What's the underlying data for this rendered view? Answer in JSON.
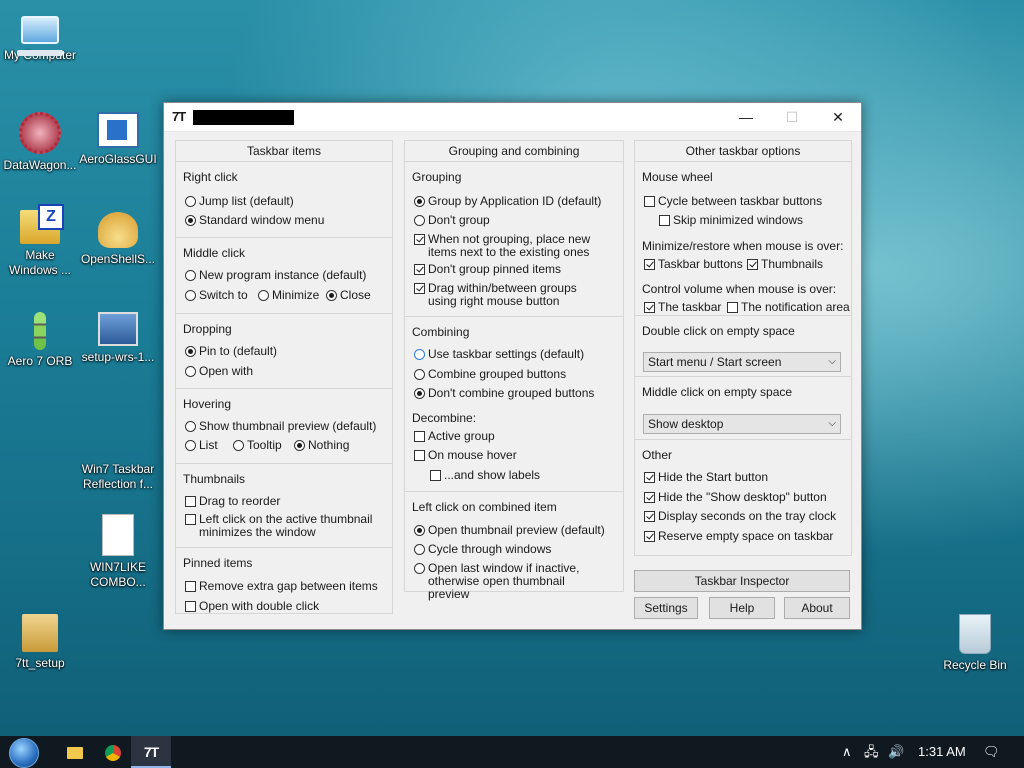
{
  "desktop": {
    "icons": [
      {
        "label": "My Computer",
        "icon": "computer-icon"
      },
      {
        "label": "DataWagon...",
        "icon": "network-icon"
      },
      {
        "label": "AeroGlassGUI",
        "icon": "window-icon"
      },
      {
        "label": "Make Windows ...",
        "icon": "zip-icon"
      },
      {
        "label": "OpenShellS...",
        "icon": "shell-icon"
      },
      {
        "label": "Aero 7 ORB",
        "icon": "orb-icon"
      },
      {
        "label": "setup-wrs-1...",
        "icon": "setup-icon"
      },
      {
        "label": "Win7 Taskbar Reflection f...",
        "icon": "blank-icon"
      },
      {
        "label": "WIN7LIKE COMBO...",
        "icon": "file-icon"
      },
      {
        "label": "7tt_setup",
        "icon": "installer-icon"
      },
      {
        "label": "Recycle Bin",
        "icon": "recycle-bin-icon"
      }
    ]
  },
  "window": {
    "app_icon": "7T",
    "controls": {
      "minimize": "—",
      "maximize": "☐",
      "close": "✕"
    }
  },
  "taskbar_items": {
    "title": "Taskbar items",
    "right_click": {
      "label": "Right click",
      "jump_list": "Jump list (default)",
      "standard_menu": "Standard window menu"
    },
    "middle_click": {
      "label": "Middle click",
      "new_instance": "New program instance (default)",
      "switch_to": "Switch to",
      "minimize": "Minimize",
      "close": "Close"
    },
    "dropping": {
      "label": "Dropping",
      "pin_to": "Pin to (default)",
      "open_with": "Open with"
    },
    "hovering": {
      "label": "Hovering",
      "show_thumbnail": "Show thumbnail preview (default)",
      "list": "List",
      "tooltip": "Tooltip",
      "nothing": "Nothing"
    },
    "thumbnails": {
      "label": "Thumbnails",
      "drag_reorder": "Drag to reorder",
      "left_click_minimizes": "Left click on the active thumbnail minimizes the window"
    },
    "pinned": {
      "label": "Pinned items",
      "remove_gap": "Remove extra gap between items",
      "open_double": "Open with double click"
    }
  },
  "grouping": {
    "title": "Grouping and combining",
    "grouping": {
      "label": "Grouping",
      "by_app_id": "Group by Application ID (default)",
      "dont_group": "Don't group",
      "when_not_grouping": "When not grouping, place new items next to the existing ones",
      "dont_group_pinned": "Don't group pinned items",
      "drag_within": "Drag within/between groups using right mouse button"
    },
    "combining": {
      "label": "Combining",
      "use_settings": "Use taskbar settings (default)",
      "combine": "Combine grouped buttons",
      "dont_combine": "Don't combine grouped buttons"
    },
    "decombine": {
      "label": "Decombine:",
      "active_group": "Active group",
      "on_hover": "On mouse hover",
      "show_labels": "...and show labels"
    },
    "left_click": {
      "label": "Left click on combined item",
      "open_preview": "Open thumbnail preview (default)",
      "cycle": "Cycle through windows",
      "open_last": "Open last window if inactive, otherwise open thumbnail preview"
    }
  },
  "other": {
    "title": "Other taskbar options",
    "mouse_wheel": {
      "label": "Mouse wheel",
      "cycle": "Cycle between taskbar buttons",
      "skip_min": "Skip minimized windows"
    },
    "minimize_restore": {
      "label": "Minimize/restore when mouse is over:",
      "taskbar_buttons": "Taskbar buttons",
      "thumbnails": "Thumbnails"
    },
    "control_volume": {
      "label": "Control volume when mouse is over:",
      "the_taskbar": "The taskbar",
      "notification_area": "The notification area"
    },
    "double_click": {
      "label": "Double click on empty space",
      "value": "Start menu / Start screen"
    },
    "middle_click": {
      "label": "Middle click on empty space",
      "value": "Show desktop"
    },
    "misc": {
      "label": "Other",
      "hide_start": "Hide the Start button",
      "hide_show_desktop": "Hide the \"Show desktop\" button",
      "display_seconds": "Display seconds on the tray clock",
      "reserve_space": "Reserve empty space on taskbar"
    }
  },
  "buttons": {
    "inspector": "Taskbar Inspector",
    "settings": "Settings",
    "help": "Help",
    "about": "About"
  },
  "taskbar": {
    "active_app": "7T",
    "tray": {
      "chevron": "∧",
      "network": "🖧",
      "volume": "🔊",
      "time": "1:31 AM",
      "notification": "🗨"
    }
  }
}
